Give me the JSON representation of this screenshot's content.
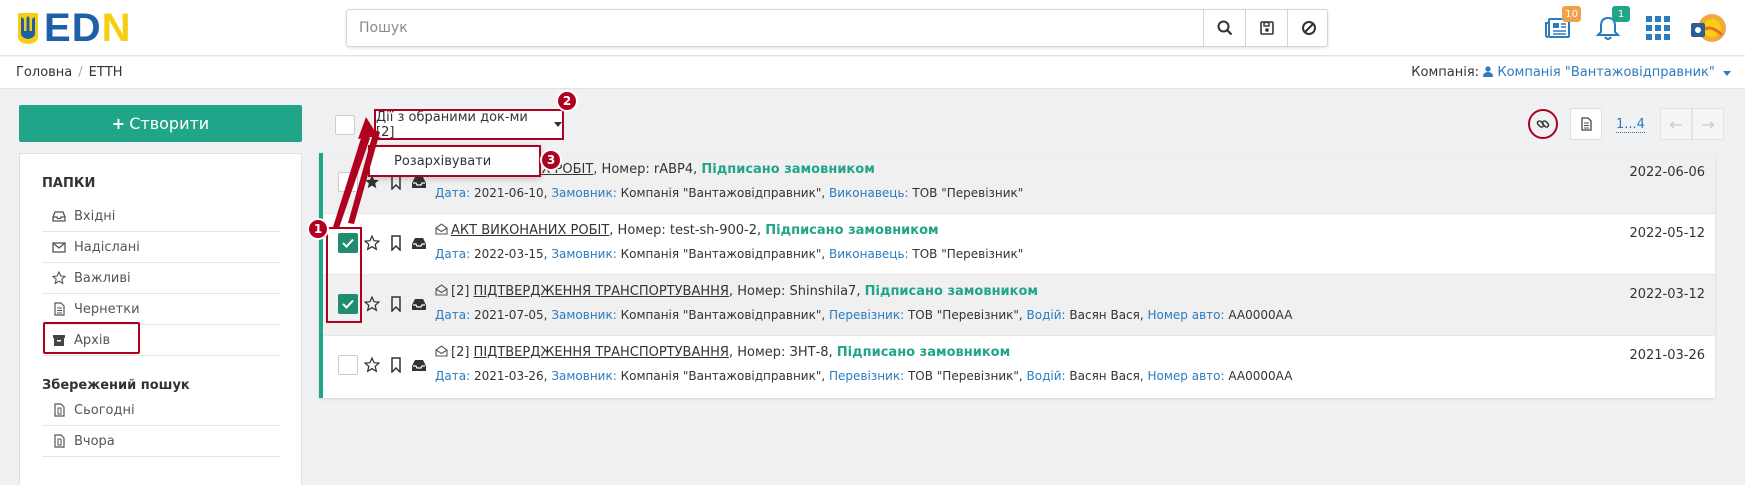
{
  "header": {
    "logo_text": "EDIN",
    "search_placeholder": "Пошук",
    "notifications": {
      "news_count": "10",
      "alerts_count": "1"
    }
  },
  "breadcrumb": {
    "home": "Головна",
    "current": "ЕТТН"
  },
  "company": {
    "label": "Компанія:",
    "name": "Компанія \"Вантажовідправник\""
  },
  "sidebar": {
    "create_label": "Створити",
    "folders_title": "ПАПКИ",
    "folders": [
      {
        "label": "Вхідні",
        "icon": "inbox-icon"
      },
      {
        "label": "Надіслані",
        "icon": "envelope-icon"
      },
      {
        "label": "Важливі",
        "icon": "star-icon"
      },
      {
        "label": "Чернетки",
        "icon": "document-icon"
      },
      {
        "label": "Архів",
        "icon": "archive-icon"
      }
    ],
    "saved_title": "Збережений пошук",
    "saved": [
      {
        "label": "Сьогодні",
        "icon": "saved-search-icon"
      },
      {
        "label": "Вчора",
        "icon": "saved-search-icon"
      }
    ]
  },
  "toolbar": {
    "actions_label": "Дії з обраними док-ми [2]",
    "dropdown_item": "Розархівувати",
    "pager": "1...4"
  },
  "annotations": [
    "1",
    "2",
    "3"
  ],
  "documents": [
    {
      "checked": false,
      "starred": true,
      "prefix": "",
      "title": "АКТ ВИКОНАНИХ РОБІТ",
      "number": ", Номер: rABP4, ",
      "status": "Підписано замовником",
      "date": "2022-06-06",
      "meta": [
        {
          "k": "Дата:",
          "v": " 2021-06-10, "
        },
        {
          "k": "Замовник:",
          "v": " Компанія \"Вантажовідправник\", "
        },
        {
          "k": "Виконавець:",
          "v": " ТОВ \"Перевізник\""
        }
      ]
    },
    {
      "checked": true,
      "starred": false,
      "prefix": "",
      "title": "АКТ ВИКОНАНИХ РОБІТ",
      "number": ", Номер: test-sh-900-2, ",
      "status": "Підписано замовником",
      "date": "2022-05-12",
      "meta": [
        {
          "k": "Дата:",
          "v": " 2022-03-15, "
        },
        {
          "k": "Замовник:",
          "v": " Компанія \"Вантажовідправник\", "
        },
        {
          "k": "Виконавець:",
          "v": " ТОВ \"Перевізник\""
        }
      ]
    },
    {
      "checked": true,
      "starred": false,
      "prefix": "[2] ",
      "title": "ПІДТВЕРДЖЕННЯ ТРАНСПОРТУВАННЯ",
      "number": ", Номер: Shinshila7, ",
      "status": "Підписано замовником",
      "date": "2022-03-12",
      "meta": [
        {
          "k": "Дата:",
          "v": " 2021-07-05, "
        },
        {
          "k": "Замовник:",
          "v": " Компанія \"Вантажовідправник\", "
        },
        {
          "k": "Перевізник:",
          "v": " ТОВ \"Перевізник\", "
        },
        {
          "k": "Водій:",
          "v": " Васян Вася, "
        },
        {
          "k": "Номер авто:",
          "v": " AA0000AA"
        }
      ]
    },
    {
      "checked": false,
      "starred": false,
      "prefix": "[2] ",
      "title": "ПІДТВЕРДЖЕННЯ ТРАНСПОРТУВАННЯ",
      "number": ", Номер: ЗНТ-8, ",
      "status": "Підписано замовником",
      "date": "2021-03-26",
      "meta": [
        {
          "k": "Дата:",
          "v": " 2021-03-26, "
        },
        {
          "k": "Замовник:",
          "v": " Компанія \"Вантажовідправник\", "
        },
        {
          "k": "Перевізник:",
          "v": " ТОВ \"Перевізник\", "
        },
        {
          "k": "Водій:",
          "v": " Васян Вася, "
        },
        {
          "k": "Номер авто:",
          "v": " AA0000AA"
        }
      ]
    }
  ],
  "colors": {
    "brand_green": "#21a589",
    "link_blue": "#2a7bc0",
    "annotation_red": "#b00020",
    "logo_blue": "#1f5fa8",
    "logo_yellow": "#f7cf12"
  }
}
